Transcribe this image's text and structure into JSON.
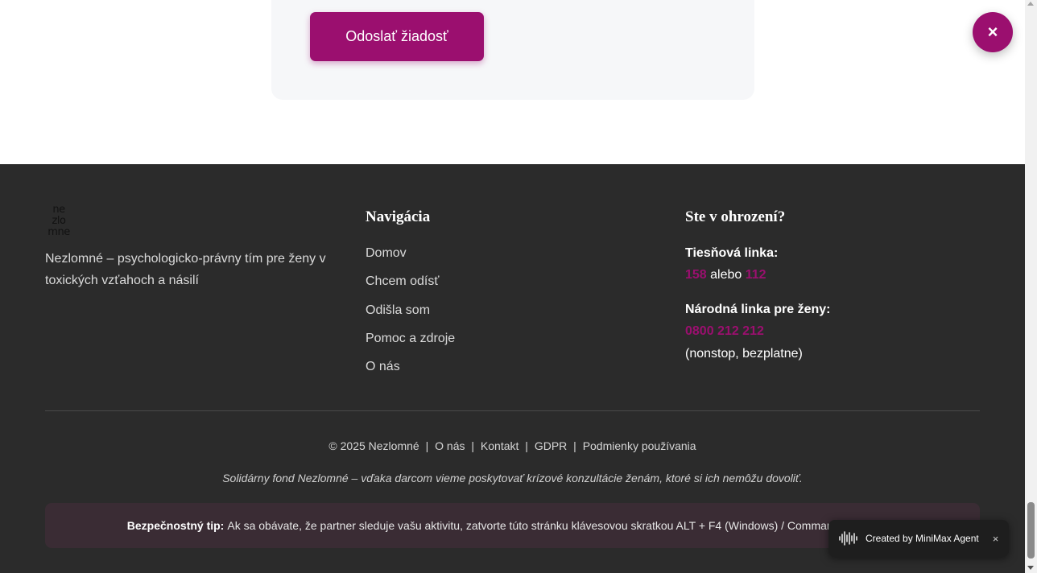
{
  "form": {
    "submit_label": "Odoslať žiadosť"
  },
  "close_fab": {
    "label": "×"
  },
  "footer": {
    "logo_text": "ne zlo mne",
    "tagline": "Nezlomné – psychologicko-právny tím pre ženy v toxických vzťahoch a násilí",
    "nav": {
      "title": "Navigácia",
      "items": [
        "Domov",
        "Chcem odísť",
        "Odišla som",
        "Pomoc a zdroje",
        "O nás"
      ]
    },
    "danger": {
      "title": "Ste v ohrození?",
      "emergency_label": "Tiesňová linka:",
      "emergency_num1": "158",
      "emergency_or": "alebo",
      "emergency_num2": "112",
      "women_label": "Národná linka pre ženy:",
      "women_num": "0800 212 212",
      "women_note": "(nonstop, bezplatne)"
    },
    "links": {
      "copyright": "© 2025 Nezlomné",
      "about": "O nás",
      "contact": "Kontakt",
      "gdpr": "GDPR",
      "terms": "Podmienky používania",
      "separator": "|"
    },
    "fund_text": "Solidárny fond Nezlomné – vďaka darcom vieme poskytovať krízové konzultácie ženám, ktoré si ich nemôžu dovoliť.",
    "tip": {
      "label": "Bezpečnostný tip:",
      "text": "Ak sa obávate, že partner sleduje vašu aktivitu, zatvorte túto stránku klávesovou skratkou ALT + F4 (Windows) / Command + W (Mac)."
    }
  },
  "badge": {
    "text": "Created by MiniMax Agent",
    "close": "×"
  },
  "colors": {
    "accent": "#9b0f6f",
    "footer_bg": "#2b2b2b",
    "tip_bg": "#3a2c34"
  }
}
